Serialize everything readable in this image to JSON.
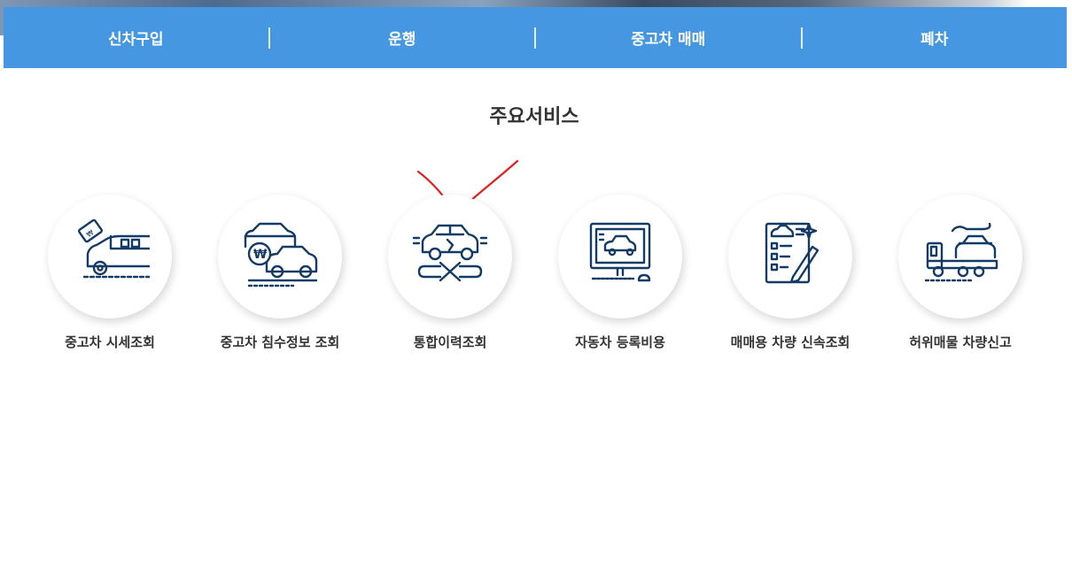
{
  "nav": {
    "items": [
      {
        "label": "신차구입"
      },
      {
        "label": "운행"
      },
      {
        "label": "중고차 매매"
      },
      {
        "label": "폐차"
      }
    ]
  },
  "main": {
    "title": "주요서비스",
    "services": [
      {
        "label": "중고차 시세조회",
        "icon": "car-price-tag-icon"
      },
      {
        "label": "중고차 침수정보 조회",
        "icon": "flood-cars-won-icon"
      },
      {
        "label": "통합이력조회",
        "icon": "car-repair-wrench-icon"
      },
      {
        "label": "자동차 등록비용",
        "icon": "monitor-car-icon"
      },
      {
        "label": "매매용 차량 신속조회",
        "icon": "document-checklist-icon"
      },
      {
        "label": "허위매물 차량신고",
        "icon": "tow-truck-icon"
      }
    ]
  },
  "annotation": {
    "type": "red-checkmark",
    "target": "통합이력조회",
    "color": "#e02020"
  },
  "colors": {
    "nav_bg": "#4497e0",
    "icon": "#143a66",
    "accent": "#2f6fc0"
  }
}
